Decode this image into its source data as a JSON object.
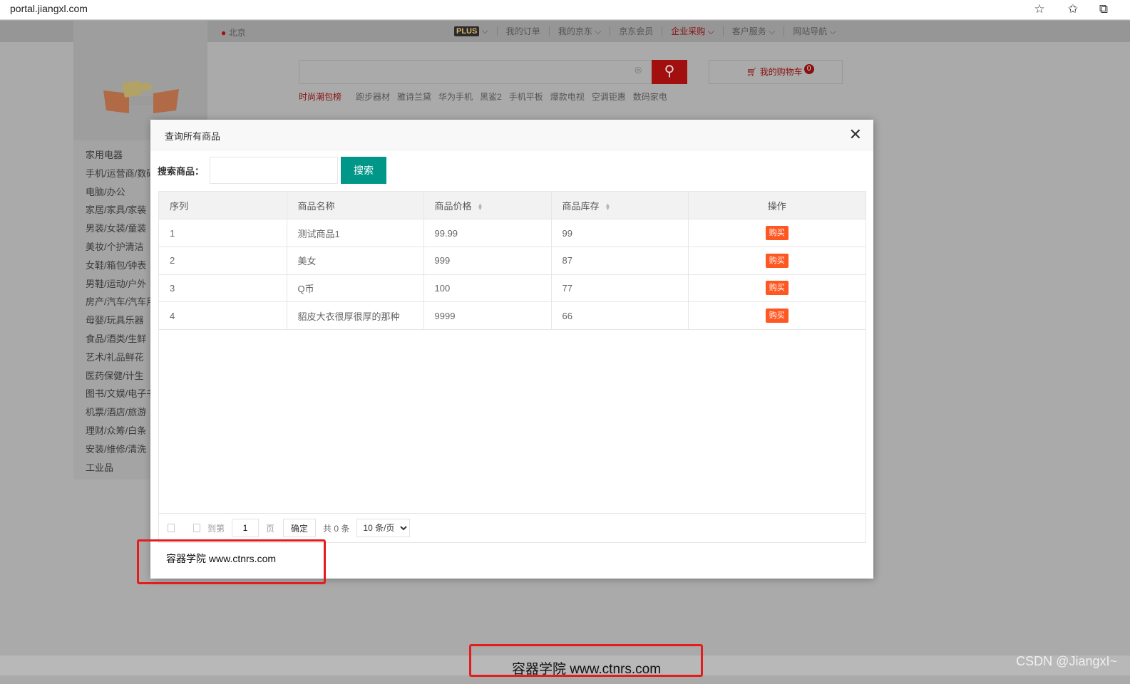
{
  "browser": {
    "url": "portal.jiangxl.com",
    "icons": [
      "star-add-icon",
      "favorites-icon",
      "collections-icon"
    ]
  },
  "topbar": {
    "location": "北京",
    "plus_badge": "PLUS",
    "nav": [
      {
        "label": "我的订单",
        "dropdown": false
      },
      {
        "label": "我的京东",
        "dropdown": true
      },
      {
        "label": "京东会员",
        "dropdown": false
      },
      {
        "label": "企业采购",
        "dropdown": true,
        "accent": true
      },
      {
        "label": "客户服务",
        "dropdown": true
      },
      {
        "label": "网站导航",
        "dropdown": true
      }
    ]
  },
  "header": {
    "search_placeholder": "",
    "cart_label": "我的购物车",
    "cart_count": "0",
    "hot_first": "时尚潮包榜",
    "hotwords": [
      "跑步器材",
      "雅诗兰黛",
      "华为手机",
      "黑鲨2",
      "手机平板",
      "爆款电视",
      "空调钜惠",
      "数码家电"
    ]
  },
  "categories": [
    "家用电器",
    "手机/运营商/数码",
    "电脑/办公",
    "家居/家具/家装",
    "男装/女装/童装",
    "美妆/个护清洁",
    "女鞋/箱包/钟表",
    "男鞋/运动/户外",
    "房产/汽车/汽车用品",
    "母婴/玩具乐器",
    "食品/酒类/生鲜",
    "艺术/礼品鲜花",
    "医药保健/计生",
    "图书/文娱/电子书",
    "机票/酒店/旅游",
    "理财/众筹/白条",
    "安装/维修/清洗",
    "工业品"
  ],
  "modal": {
    "title": "查询所有商品",
    "search_label": "搜索商品：",
    "search_value": "",
    "search_button": "搜索",
    "columns": [
      "序列",
      "商品名称",
      "商品价格",
      "商品库存",
      "操作"
    ],
    "rows": [
      {
        "id": "1",
        "name": "测试商品1",
        "price": "99.99",
        "stock": "99",
        "action": "购买"
      },
      {
        "id": "2",
        "name": "美女",
        "price": "999",
        "stock": "87",
        "action": "购买"
      },
      {
        "id": "3",
        "name": "Q币",
        "price": "100",
        "stock": "77",
        "action": "购买"
      },
      {
        "id": "4",
        "name": "貂皮大衣很厚很厚的那种",
        "price": "9999",
        "stock": "66",
        "action": "购买"
      }
    ],
    "pager": {
      "goto_label": "到第",
      "page_value": "1",
      "page_unit": "页",
      "confirm": "确定",
      "total": "共 0 条",
      "page_size": "10 条/页"
    },
    "footer_text": "容器学院 www.ctnrs.com"
  },
  "page_footer_text": "容器学院 www.ctnrs.com",
  "csdn_watermark": "CSDN @JiangxI~",
  "colors": {
    "search_button": "#009688",
    "buy_button": "#ff5722",
    "annotation_box": "#e51c1c"
  }
}
